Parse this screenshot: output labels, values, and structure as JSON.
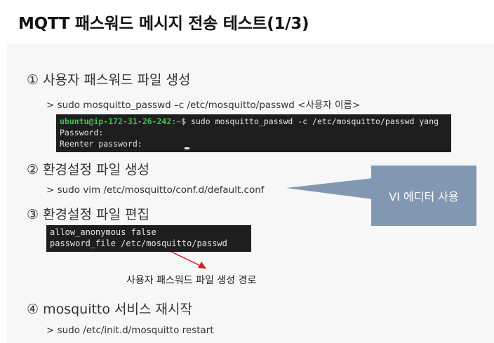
{
  "title": "MQTT 패스워드 메시지 전송 테스트(1/3)",
  "steps": [
    {
      "label": "① 사용자 패스워드 파일 생성",
      "command": "> sudo mosquitto_passwd –c /etc/mosquitto/passwd <사용자 이름>"
    },
    {
      "label": "② 환경설정 파일 생성",
      "command": "> sudo vim /etc/mosquitto/conf.d/default.conf"
    },
    {
      "label": "③ 환경설정 파일 편집"
    },
    {
      "label": "④ mosquitto 서비스 재시작",
      "command": "> sudo /etc/init.d/mosquitto restart"
    }
  ],
  "terminal1": {
    "prompt_user": "ubuntu@ip-172-31-26-242",
    "prompt_path": ":~",
    "prompt_cmd": "$ sudo mosquitto_passwd -c /etc/mosquitto/passwd yang",
    "line2": "Password:",
    "line3": "Reenter password:"
  },
  "terminal2": {
    "line1": "allow_anonymous false",
    "line2": "password_file /etc/mosquitto/passwd"
  },
  "callout": "VI 에디터 사용",
  "annotation": "사용자 패스워드 파일 생성 경로",
  "colors": {
    "callout_bg": "#8297b2",
    "underline": "#d81e1e",
    "terminal_bg": "#1e1e1e",
    "prompt_user": "#3ec34e",
    "prompt_path": "#5c8fdf"
  }
}
